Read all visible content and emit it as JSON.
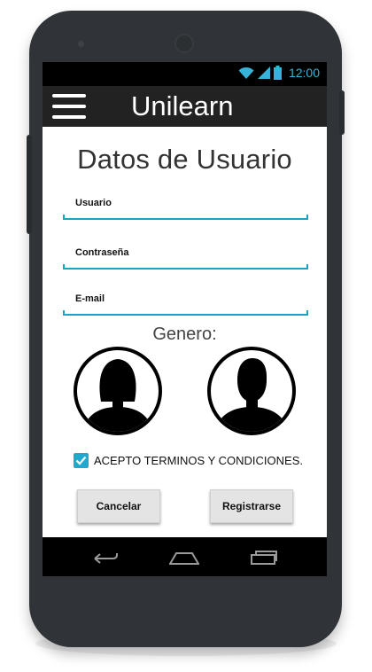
{
  "status_bar": {
    "time": "12:00",
    "icons": [
      "wifi-icon",
      "signal-icon",
      "battery-icon"
    ]
  },
  "app_bar": {
    "menu_icon": "hamburger-menu-icon",
    "title": "Unilearn"
  },
  "form": {
    "heading": "Datos de Usuario",
    "fields": [
      {
        "label": "Usuario",
        "value": ""
      },
      {
        "label": "Contraseña",
        "value": ""
      },
      {
        "label": "E-mail",
        "value": ""
      }
    ],
    "gender_label": "Genero:",
    "gender_options": [
      "female-avatar-icon",
      "male-avatar-icon"
    ],
    "terms": {
      "checked": true,
      "label": "ACEPTO TERMINOS Y CONDICIONES."
    },
    "cancel_label": "Cancelar",
    "register_label": "Registrarse"
  },
  "nav_bar": {
    "icons": [
      "back-icon",
      "home-icon",
      "recent-apps-icon"
    ]
  },
  "colors": {
    "accent": "#21a8d1",
    "app_bar": "#222222",
    "phone_body": "#303438"
  }
}
